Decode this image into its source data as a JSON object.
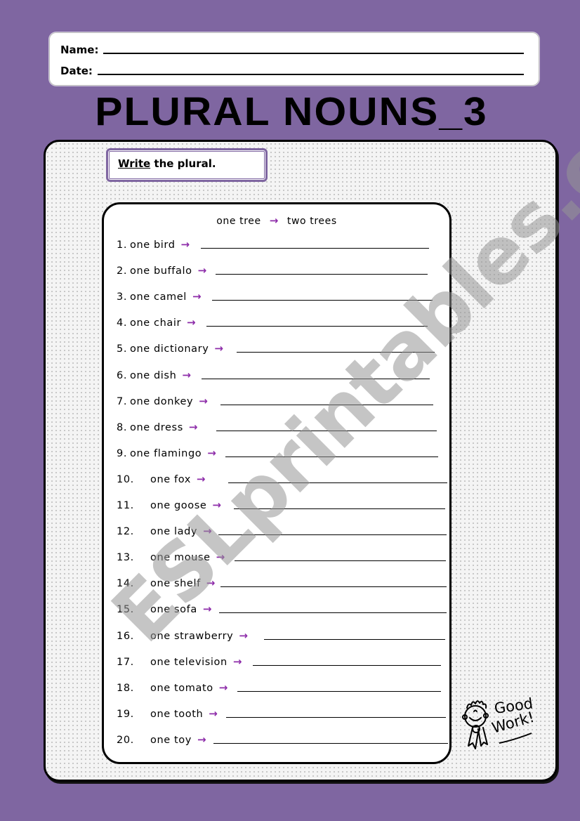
{
  "header": {
    "name_label": "Name:",
    "date_label": "Date:"
  },
  "title": "PLURAL NOUNS_3",
  "instruction": {
    "verb": "Write",
    "rest": " the plural."
  },
  "example": {
    "singular": "one tree",
    "arrow": "→",
    "plural": "two trees"
  },
  "arrow_color": "#8d2ca9",
  "background_color": "#7f66a1",
  "items": [
    {
      "num": "1.",
      "noun": "one bird"
    },
    {
      "num": "2.",
      "noun": "one buffalo"
    },
    {
      "num": "3.",
      "noun": "one camel"
    },
    {
      "num": "4.",
      "noun": "one chair"
    },
    {
      "num": "5.",
      "noun": "one dictionary"
    },
    {
      "num": "6.",
      "noun": "one dish"
    },
    {
      "num": "7.",
      "noun": "one donkey"
    },
    {
      "num": "8.",
      "noun": "one dress"
    },
    {
      "num": "9.",
      "noun": "one flamingo"
    },
    {
      "num": "10.",
      "noun": "one fox"
    },
    {
      "num": "11.",
      "noun": "one goose"
    },
    {
      "num": "12.",
      "noun": "one lady"
    },
    {
      "num": "13.",
      "noun": "one mouse"
    },
    {
      "num": "14.",
      "noun": "one shelf"
    },
    {
      "num": "15.",
      "noun": "one sofa"
    },
    {
      "num": "16.",
      "noun": "one strawberry"
    },
    {
      "num": "17.",
      "noun": "one television"
    },
    {
      "num": "18.",
      "noun": "one tomato"
    },
    {
      "num": "19.",
      "noun": "one tooth"
    },
    {
      "num": "20.",
      "noun": "one toy"
    }
  ],
  "arrow_glyph": "→",
  "sticker": {
    "line1": "Good",
    "line2": "Work!"
  },
  "watermark": "ESLprintables.com"
}
